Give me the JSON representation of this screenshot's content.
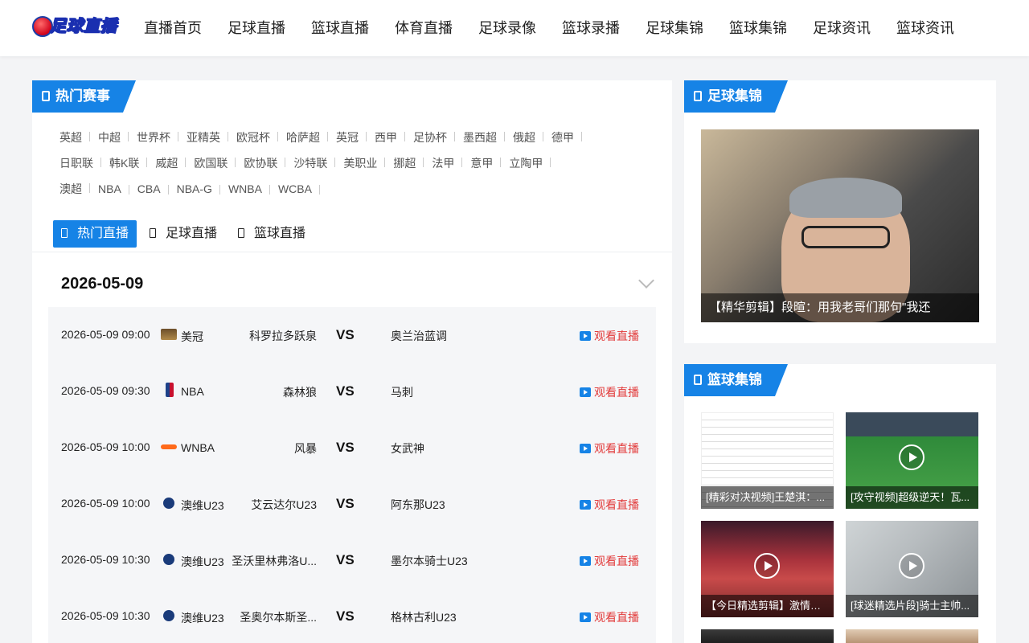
{
  "header": {
    "logo_text": "足球直播",
    "nav": [
      "直播首页",
      "足球直播",
      "篮球直播",
      "体育直播",
      "足球录像",
      "篮球录播",
      "足球集锦",
      "篮球集锦",
      "足球资讯",
      "篮球资讯"
    ]
  },
  "hot": {
    "title": "热门赛事",
    "leagues": [
      [
        "英超",
        "中超",
        "世界杯",
        "亚精英",
        "欧冠杯",
        "哈萨超",
        "英冠",
        "西甲",
        "足协杯",
        "墨西超",
        "俄超",
        "德甲"
      ],
      [
        "日职联",
        "韩K联",
        "威超",
        "欧国联",
        "欧协联",
        "沙特联",
        "美职业",
        "挪超",
        "法甲",
        "意甲",
        "立陶甲"
      ],
      [
        "澳超",
        "NBA",
        "CBA",
        "NBA-G",
        "WNBA",
        "WCBA"
      ]
    ],
    "tabs": [
      "热门直播",
      "足球直播",
      "篮球直播"
    ],
    "date": "2026-05-09",
    "vs": "VS",
    "watch": "观看直播",
    "matches": [
      {
        "time": "2026-05-09 09:00",
        "icon": "mg-icon",
        "league": "美冠",
        "home": "科罗拉多跃泉",
        "away": "奥兰治蓝调"
      },
      {
        "time": "2026-05-09 09:30",
        "icon": "nba-icon",
        "league": "NBA",
        "home": "森林狼",
        "away": "马刺"
      },
      {
        "time": "2026-05-09 10:00",
        "icon": "wnba-icon",
        "league": "WNBA",
        "home": "风暴",
        "away": "女武神"
      },
      {
        "time": "2026-05-09 10:00",
        "icon": "aus-icon",
        "league": "澳维U23",
        "home": "艾云达尔U23",
        "away": "阿东那U23"
      },
      {
        "time": "2026-05-09 10:30",
        "icon": "aus-icon",
        "league": "澳维U23",
        "home": "圣沃里林弗洛U...",
        "away": "墨尔本骑士U23"
      },
      {
        "time": "2026-05-09 10:30",
        "icon": "aus-icon",
        "league": "澳维U23",
        "home": "圣奥尔本斯圣...",
        "away": "格林古利U23"
      }
    ]
  },
  "football_highlights": {
    "title": "足球集锦",
    "featured_caption": "【精华剪辑】段暄：用我老哥们那句\"我还"
  },
  "basketball_highlights": {
    "title": "篮球集锦",
    "items": [
      {
        "caption": "[精彩对决视频]王楚淇：..."
      },
      {
        "caption": "[攻守视频]超级逆天！瓦..."
      },
      {
        "caption": "【今日精选剪辑】激情欧..."
      },
      {
        "caption": "[球迷精选片段]骑士主帅..."
      }
    ]
  }
}
